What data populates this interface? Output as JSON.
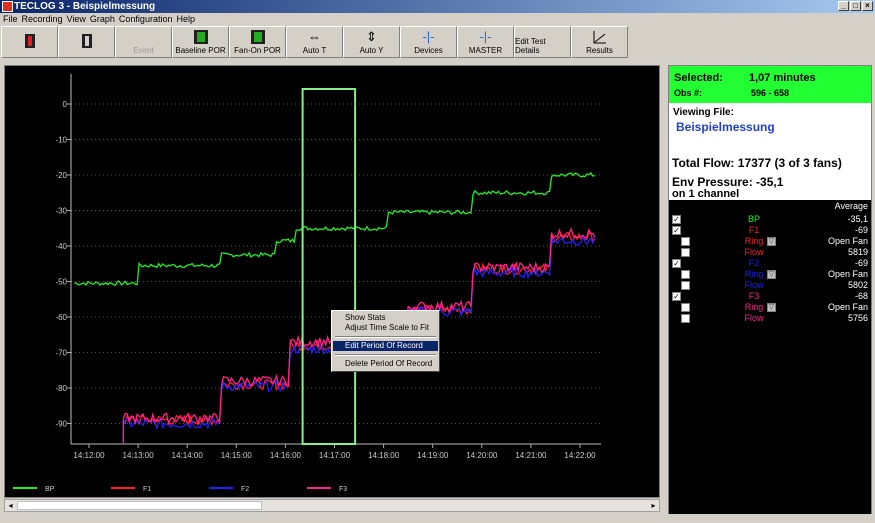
{
  "window": {
    "title": "TECLOG 3 - Beispielmessung"
  },
  "menu": [
    "File",
    "Recording",
    "View",
    "Graph",
    "Configuration",
    "Help"
  ],
  "toolbar": [
    {
      "label": "",
      "icon": "record-red-icon",
      "disabled": false
    },
    {
      "label": "",
      "icon": "stop-icon",
      "disabled": false
    },
    {
      "label": "Event",
      "icon": "event-icon",
      "disabled": true
    },
    {
      "label": "Baseline POR",
      "icon": "baseline-por-icon",
      "disabled": false
    },
    {
      "label": "Fan-On POR",
      "icon": "fan-on-por-icon",
      "disabled": false
    },
    {
      "label": "Auto T",
      "icon": "auto-t-icon",
      "disabled": false
    },
    {
      "label": "Auto Y",
      "icon": "auto-y-icon",
      "disabled": false
    },
    {
      "label": "Devices",
      "icon": "devices-icon",
      "disabled": false
    },
    {
      "label": "MASTER",
      "icon": "master-icon",
      "disabled": false
    },
    {
      "label": "Edit Test Details",
      "icon": "",
      "disabled": false
    },
    {
      "label": "Results",
      "icon": "results-icon",
      "disabled": false
    }
  ],
  "selected": {
    "label": "Selected:",
    "value": "1,07 minutes",
    "obs_label": "Obs #:",
    "obs_value": "596 - 658"
  },
  "viewing_file": {
    "label": "Viewing File:",
    "name": "Beispielmessung"
  },
  "total_flow": "Total Flow: 17377 (3 of 3 fans)",
  "env_pressure": "Env Pressure: -35,1",
  "on_channel": "on 1 channel",
  "legend_header": "Average",
  "channels": [
    {
      "name": "BP",
      "color": "#22ee22",
      "checked": true,
      "value": "-35,1",
      "indent": false
    },
    {
      "name": "F1",
      "color": "#ff2020",
      "checked": true,
      "value": "-69",
      "indent": false
    },
    {
      "name": "Ring",
      "color": "#ff2020",
      "checked": false,
      "value": "Open Fan",
      "indent": true,
      "range": true
    },
    {
      "name": "Flow",
      "color": "#ff2020",
      "checked": false,
      "value": "5819",
      "indent": true
    },
    {
      "name": "F2",
      "color": "#2020ff",
      "checked": true,
      "value": "-69",
      "indent": false
    },
    {
      "name": "Ring",
      "color": "#2020ff",
      "checked": false,
      "value": "Open Fan",
      "indent": true,
      "range": true
    },
    {
      "name": "Flow",
      "color": "#2020ff",
      "checked": false,
      "value": "5802",
      "indent": true
    },
    {
      "name": "F3",
      "color": "#ff2288",
      "checked": true,
      "value": "-68",
      "indent": false
    },
    {
      "name": "Ring",
      "color": "#ff2288",
      "checked": false,
      "value": "Open Fan",
      "indent": true,
      "range": true
    },
    {
      "name": "Flow",
      "color": "#ff2288",
      "checked": false,
      "value": "5756",
      "indent": true
    }
  ],
  "context_menu": {
    "items": [
      "Show Stats",
      "Adjust Time Scale to Fit",
      "Edit Period Of Record",
      "Delete Period Of Record"
    ],
    "active_index": 2
  },
  "chart_data": {
    "type": "line",
    "x_ticks": [
      "14:12:00",
      "14:13:00",
      "14:14:00",
      "14:15:00",
      "14:16:00",
      "14:17:00",
      "14:18:00",
      "14:19:00",
      "14:20:00",
      "14:21:00",
      "14:22:00"
    ],
    "y_ticks": [
      0,
      -10,
      -20,
      -30,
      -40,
      -50,
      -60,
      -70,
      -80,
      -90
    ],
    "ylim": [
      -96,
      4
    ],
    "xlim_minutes": [
      -0.3,
      10.3
    ],
    "grid": true,
    "selection_minutes": [
      4.35,
      5.42
    ],
    "series": [
      {
        "name": "BP",
        "color": "#22ee22",
        "steps": [
          [
            -0.3,
            -50.5
          ],
          [
            1.0,
            -45.5
          ],
          [
            2.7,
            -42.5
          ],
          [
            3.8,
            -38.5
          ],
          [
            4.2,
            -35
          ],
          [
            6.1,
            -30.5
          ],
          [
            7.8,
            -25
          ],
          [
            9.4,
            -20
          ]
        ]
      },
      {
        "name": "F1",
        "color": "#ff2020",
        "steps": [
          [
            0.7,
            -89
          ],
          [
            1.9,
            -89
          ],
          [
            2.7,
            -79
          ],
          [
            4.1,
            -68
          ],
          [
            5.4,
            -64
          ],
          [
            6.5,
            -58
          ],
          [
            7.8,
            -46.5
          ],
          [
            9.4,
            -37.5
          ]
        ]
      },
      {
        "name": "F2",
        "color": "#2020ff",
        "steps": [
          [
            0.7,
            -90
          ],
          [
            1.9,
            -90
          ],
          [
            2.7,
            -79.5
          ],
          [
            4.1,
            -69
          ],
          [
            5.4,
            -65
          ],
          [
            6.5,
            -58.5
          ],
          [
            7.8,
            -47.5
          ],
          [
            9.4,
            -38.5
          ]
        ]
      },
      {
        "name": "F3",
        "color": "#ff2288",
        "steps": [
          [
            0.7,
            -88.5
          ],
          [
            1.9,
            -88.5
          ],
          [
            2.7,
            -78
          ],
          [
            4.1,
            -67
          ],
          [
            5.4,
            -63
          ],
          [
            6.5,
            -57
          ],
          [
            7.8,
            -46
          ],
          [
            9.4,
            -36.5
          ]
        ]
      }
    ]
  }
}
